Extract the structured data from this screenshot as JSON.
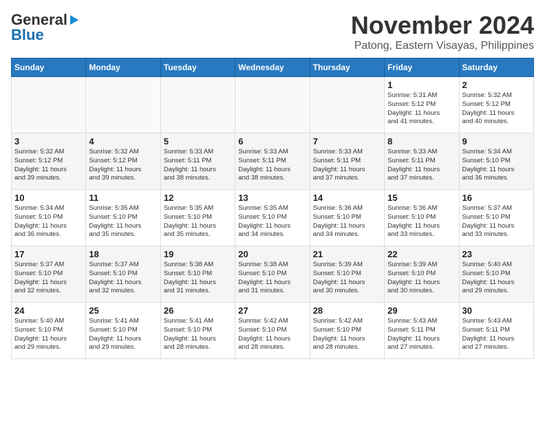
{
  "header": {
    "logo_line1": "General",
    "logo_line2": "Blue",
    "month_title": "November 2024",
    "location": "Patong, Eastern Visayas, Philippines"
  },
  "days_of_week": [
    "Sunday",
    "Monday",
    "Tuesday",
    "Wednesday",
    "Thursday",
    "Friday",
    "Saturday"
  ],
  "weeks": [
    [
      {
        "day": "",
        "content": ""
      },
      {
        "day": "",
        "content": ""
      },
      {
        "day": "",
        "content": ""
      },
      {
        "day": "",
        "content": ""
      },
      {
        "day": "",
        "content": ""
      },
      {
        "day": "1",
        "content": "Sunrise: 5:31 AM\nSunset: 5:12 PM\nDaylight: 11 hours\nand 41 minutes."
      },
      {
        "day": "2",
        "content": "Sunrise: 5:32 AM\nSunset: 5:12 PM\nDaylight: 11 hours\nand 40 minutes."
      }
    ],
    [
      {
        "day": "3",
        "content": "Sunrise: 5:32 AM\nSunset: 5:12 PM\nDaylight: 11 hours\nand 39 minutes."
      },
      {
        "day": "4",
        "content": "Sunrise: 5:32 AM\nSunset: 5:12 PM\nDaylight: 11 hours\nand 39 minutes."
      },
      {
        "day": "5",
        "content": "Sunrise: 5:33 AM\nSunset: 5:11 PM\nDaylight: 11 hours\nand 38 minutes."
      },
      {
        "day": "6",
        "content": "Sunrise: 5:33 AM\nSunset: 5:11 PM\nDaylight: 11 hours\nand 38 minutes."
      },
      {
        "day": "7",
        "content": "Sunrise: 5:33 AM\nSunset: 5:11 PM\nDaylight: 11 hours\nand 37 minutes."
      },
      {
        "day": "8",
        "content": "Sunrise: 5:33 AM\nSunset: 5:11 PM\nDaylight: 11 hours\nand 37 minutes."
      },
      {
        "day": "9",
        "content": "Sunrise: 5:34 AM\nSunset: 5:10 PM\nDaylight: 11 hours\nand 36 minutes."
      }
    ],
    [
      {
        "day": "10",
        "content": "Sunrise: 5:34 AM\nSunset: 5:10 PM\nDaylight: 11 hours\nand 36 minutes."
      },
      {
        "day": "11",
        "content": "Sunrise: 5:35 AM\nSunset: 5:10 PM\nDaylight: 11 hours\nand 35 minutes."
      },
      {
        "day": "12",
        "content": "Sunrise: 5:35 AM\nSunset: 5:10 PM\nDaylight: 11 hours\nand 35 minutes."
      },
      {
        "day": "13",
        "content": "Sunrise: 5:35 AM\nSunset: 5:10 PM\nDaylight: 11 hours\nand 34 minutes."
      },
      {
        "day": "14",
        "content": "Sunrise: 5:36 AM\nSunset: 5:10 PM\nDaylight: 11 hours\nand 34 minutes."
      },
      {
        "day": "15",
        "content": "Sunrise: 5:36 AM\nSunset: 5:10 PM\nDaylight: 11 hours\nand 33 minutes."
      },
      {
        "day": "16",
        "content": "Sunrise: 5:37 AM\nSunset: 5:10 PM\nDaylight: 11 hours\nand 33 minutes."
      }
    ],
    [
      {
        "day": "17",
        "content": "Sunrise: 5:37 AM\nSunset: 5:10 PM\nDaylight: 11 hours\nand 32 minutes."
      },
      {
        "day": "18",
        "content": "Sunrise: 5:37 AM\nSunset: 5:10 PM\nDaylight: 11 hours\nand 32 minutes."
      },
      {
        "day": "19",
        "content": "Sunrise: 5:38 AM\nSunset: 5:10 PM\nDaylight: 11 hours\nand 31 minutes."
      },
      {
        "day": "20",
        "content": "Sunrise: 5:38 AM\nSunset: 5:10 PM\nDaylight: 11 hours\nand 31 minutes."
      },
      {
        "day": "21",
        "content": "Sunrise: 5:39 AM\nSunset: 5:10 PM\nDaylight: 11 hours\nand 30 minutes."
      },
      {
        "day": "22",
        "content": "Sunrise: 5:39 AM\nSunset: 5:10 PM\nDaylight: 11 hours\nand 30 minutes."
      },
      {
        "day": "23",
        "content": "Sunrise: 5:40 AM\nSunset: 5:10 PM\nDaylight: 11 hours\nand 29 minutes."
      }
    ],
    [
      {
        "day": "24",
        "content": "Sunrise: 5:40 AM\nSunset: 5:10 PM\nDaylight: 11 hours\nand 29 minutes."
      },
      {
        "day": "25",
        "content": "Sunrise: 5:41 AM\nSunset: 5:10 PM\nDaylight: 11 hours\nand 29 minutes."
      },
      {
        "day": "26",
        "content": "Sunrise: 5:41 AM\nSunset: 5:10 PM\nDaylight: 11 hours\nand 28 minutes."
      },
      {
        "day": "27",
        "content": "Sunrise: 5:42 AM\nSunset: 5:10 PM\nDaylight: 11 hours\nand 28 minutes."
      },
      {
        "day": "28",
        "content": "Sunrise: 5:42 AM\nSunset: 5:10 PM\nDaylight: 11 hours\nand 28 minutes."
      },
      {
        "day": "29",
        "content": "Sunrise: 5:43 AM\nSunset: 5:11 PM\nDaylight: 11 hours\nand 27 minutes."
      },
      {
        "day": "30",
        "content": "Sunrise: 5:43 AM\nSunset: 5:11 PM\nDaylight: 11 hours\nand 27 minutes."
      }
    ]
  ]
}
